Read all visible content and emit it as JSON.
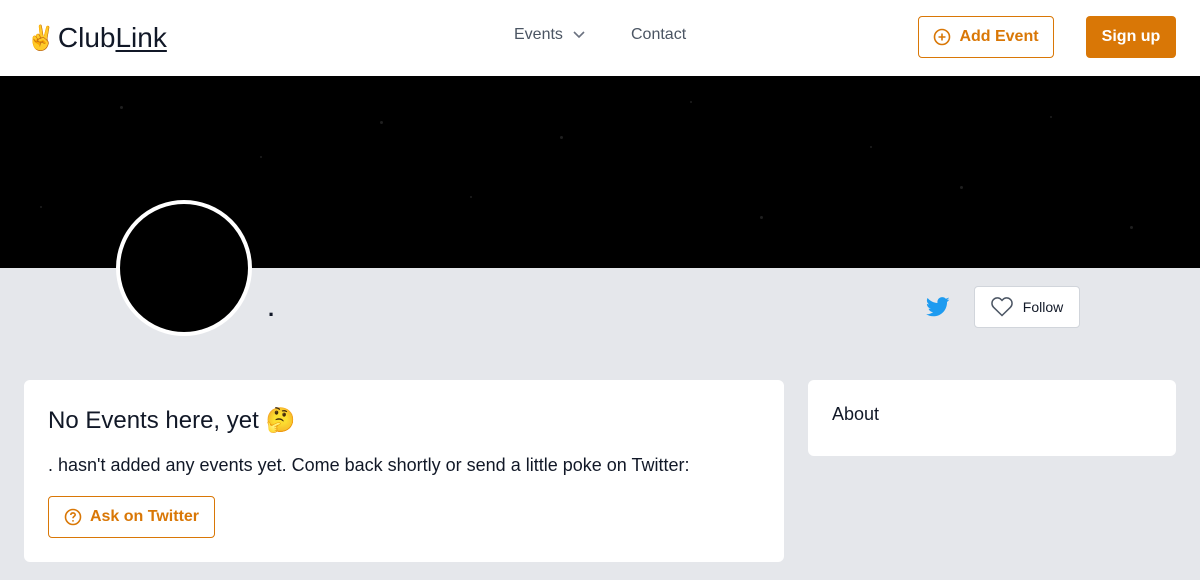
{
  "header": {
    "logo_emoji": "✌️",
    "logo_club": "Club",
    "logo_link": "Link",
    "nav_events": "Events",
    "nav_contact": "Contact",
    "add_event_label": "Add Event",
    "signup_label": "Sign up"
  },
  "profile": {
    "club_name": ".",
    "follow_label": "Follow"
  },
  "events_card": {
    "title": "No Events here, yet 🤔",
    "message": ". hasn't added any events yet. Come back shortly or send a little poke on Twitter:",
    "ask_label": "Ask on Twitter"
  },
  "about_card": {
    "title": "About"
  },
  "colors": {
    "accent": "#d97706",
    "twitter": "#1d9bf0",
    "page_bg": "#e5e7eb"
  },
  "icons": [
    "chevron-down-icon",
    "plus-circle-icon",
    "twitter-icon",
    "heart-icon",
    "question-circle-icon"
  ]
}
